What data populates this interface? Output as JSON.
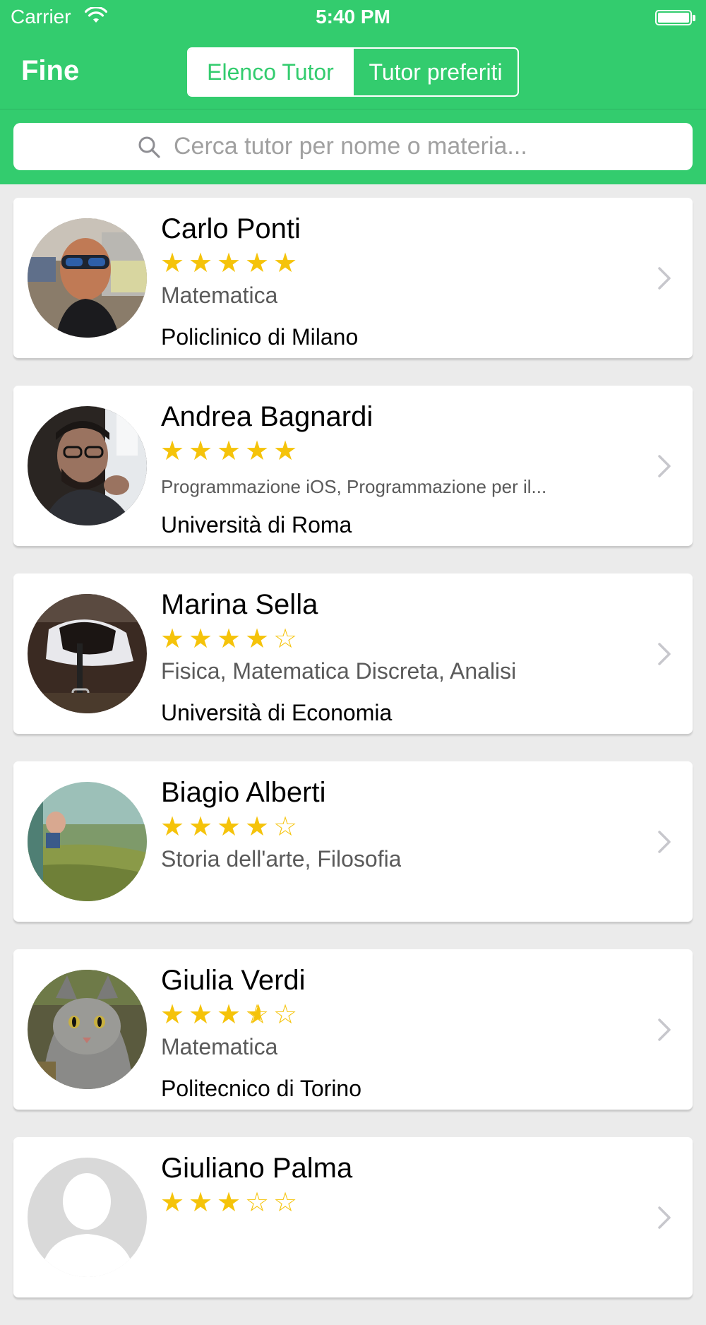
{
  "status_bar": {
    "carrier": "Carrier",
    "time": "5:40 PM"
  },
  "nav": {
    "left_button": "Fine",
    "segments": [
      "Elenco Tutor",
      "Tutor preferiti"
    ],
    "selected_segment": 0
  },
  "search": {
    "placeholder": "Cerca tutor per nome o materia..."
  },
  "colors": {
    "accent": "#33cc6e",
    "star": "#f5c30a",
    "background": "#ebebeb"
  },
  "tutors": [
    {
      "name": "Carlo Ponti",
      "rating": 5,
      "subjects": "Matematica",
      "university": "Policlinico di Milano",
      "avatar": "photo-young-man-sunglasses"
    },
    {
      "name": "Andrea Bagnardi",
      "rating": 5,
      "subjects": "Programmazione iOS, Programmazione per il...",
      "university": "Università di Roma",
      "avatar": "photo-man-glasses-beard"
    },
    {
      "name": "Marina Sella",
      "rating": 4,
      "subjects": "Fisica, Matematica Discreta, Analisi",
      "university": "Università di Economia",
      "avatar": "photo-horse-saddle"
    },
    {
      "name": "Biagio Alberti",
      "rating": 4,
      "subjects": "Storia dell'arte, Filosofia",
      "university": "",
      "avatar": "photo-train-window-landscape"
    },
    {
      "name": "Giulia Verdi",
      "rating": 3.5,
      "subjects": "Matematica",
      "university": "Politecnico di Torino",
      "avatar": "photo-cat-selfie"
    },
    {
      "name": "Giuliano Palma",
      "rating": 3,
      "subjects": "",
      "university": "",
      "avatar": "placeholder-person"
    }
  ]
}
